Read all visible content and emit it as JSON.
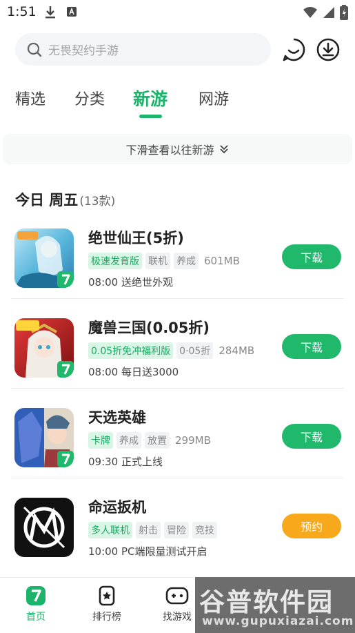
{
  "statusbar": {
    "time": "1:51"
  },
  "search": {
    "placeholder": "无畏契约手游"
  },
  "tabs": [
    {
      "label": "精选"
    },
    {
      "label": "分类"
    },
    {
      "label": "新游"
    },
    {
      "label": "网游"
    }
  ],
  "history": {
    "label": "下滑查看以往新游"
  },
  "section": {
    "title": "今日 周五",
    "count": "(13款)"
  },
  "games": [
    {
      "name": "绝世仙王(5折)",
      "tags": [
        "极速发育版",
        "联机",
        "养成"
      ],
      "size": "601MB",
      "desc": "08:00  送绝世外观",
      "button": "下载"
    },
    {
      "name": "魔兽三国(0.05折)",
      "tags": [
        "0.05折免冲福利版",
        "0·05折"
      ],
      "size": "284MB",
      "desc": "08:00  每日送3000",
      "button": "下载"
    },
    {
      "name": "天选英雄",
      "tags": [
        "卡牌",
        "养成",
        "放置"
      ],
      "size": "299MB",
      "desc": "09:30  正式上线",
      "button": "下载"
    },
    {
      "name": "命运扳机",
      "tags": [
        "多人联机",
        "射击",
        "冒险",
        "竞技"
      ],
      "size": "",
      "desc": "10:00  PC端限量测试开启",
      "button": "预约"
    }
  ],
  "nav": [
    {
      "label": "首页"
    },
    {
      "label": "排行榜"
    },
    {
      "label": "找游戏"
    }
  ],
  "watermark": {
    "title": "谷普软件园",
    "url": "www.gupuxiazai.com"
  },
  "colors": {
    "accent": "#1cb46b",
    "download": "#20b86b",
    "reserve": "#f8a81b"
  }
}
